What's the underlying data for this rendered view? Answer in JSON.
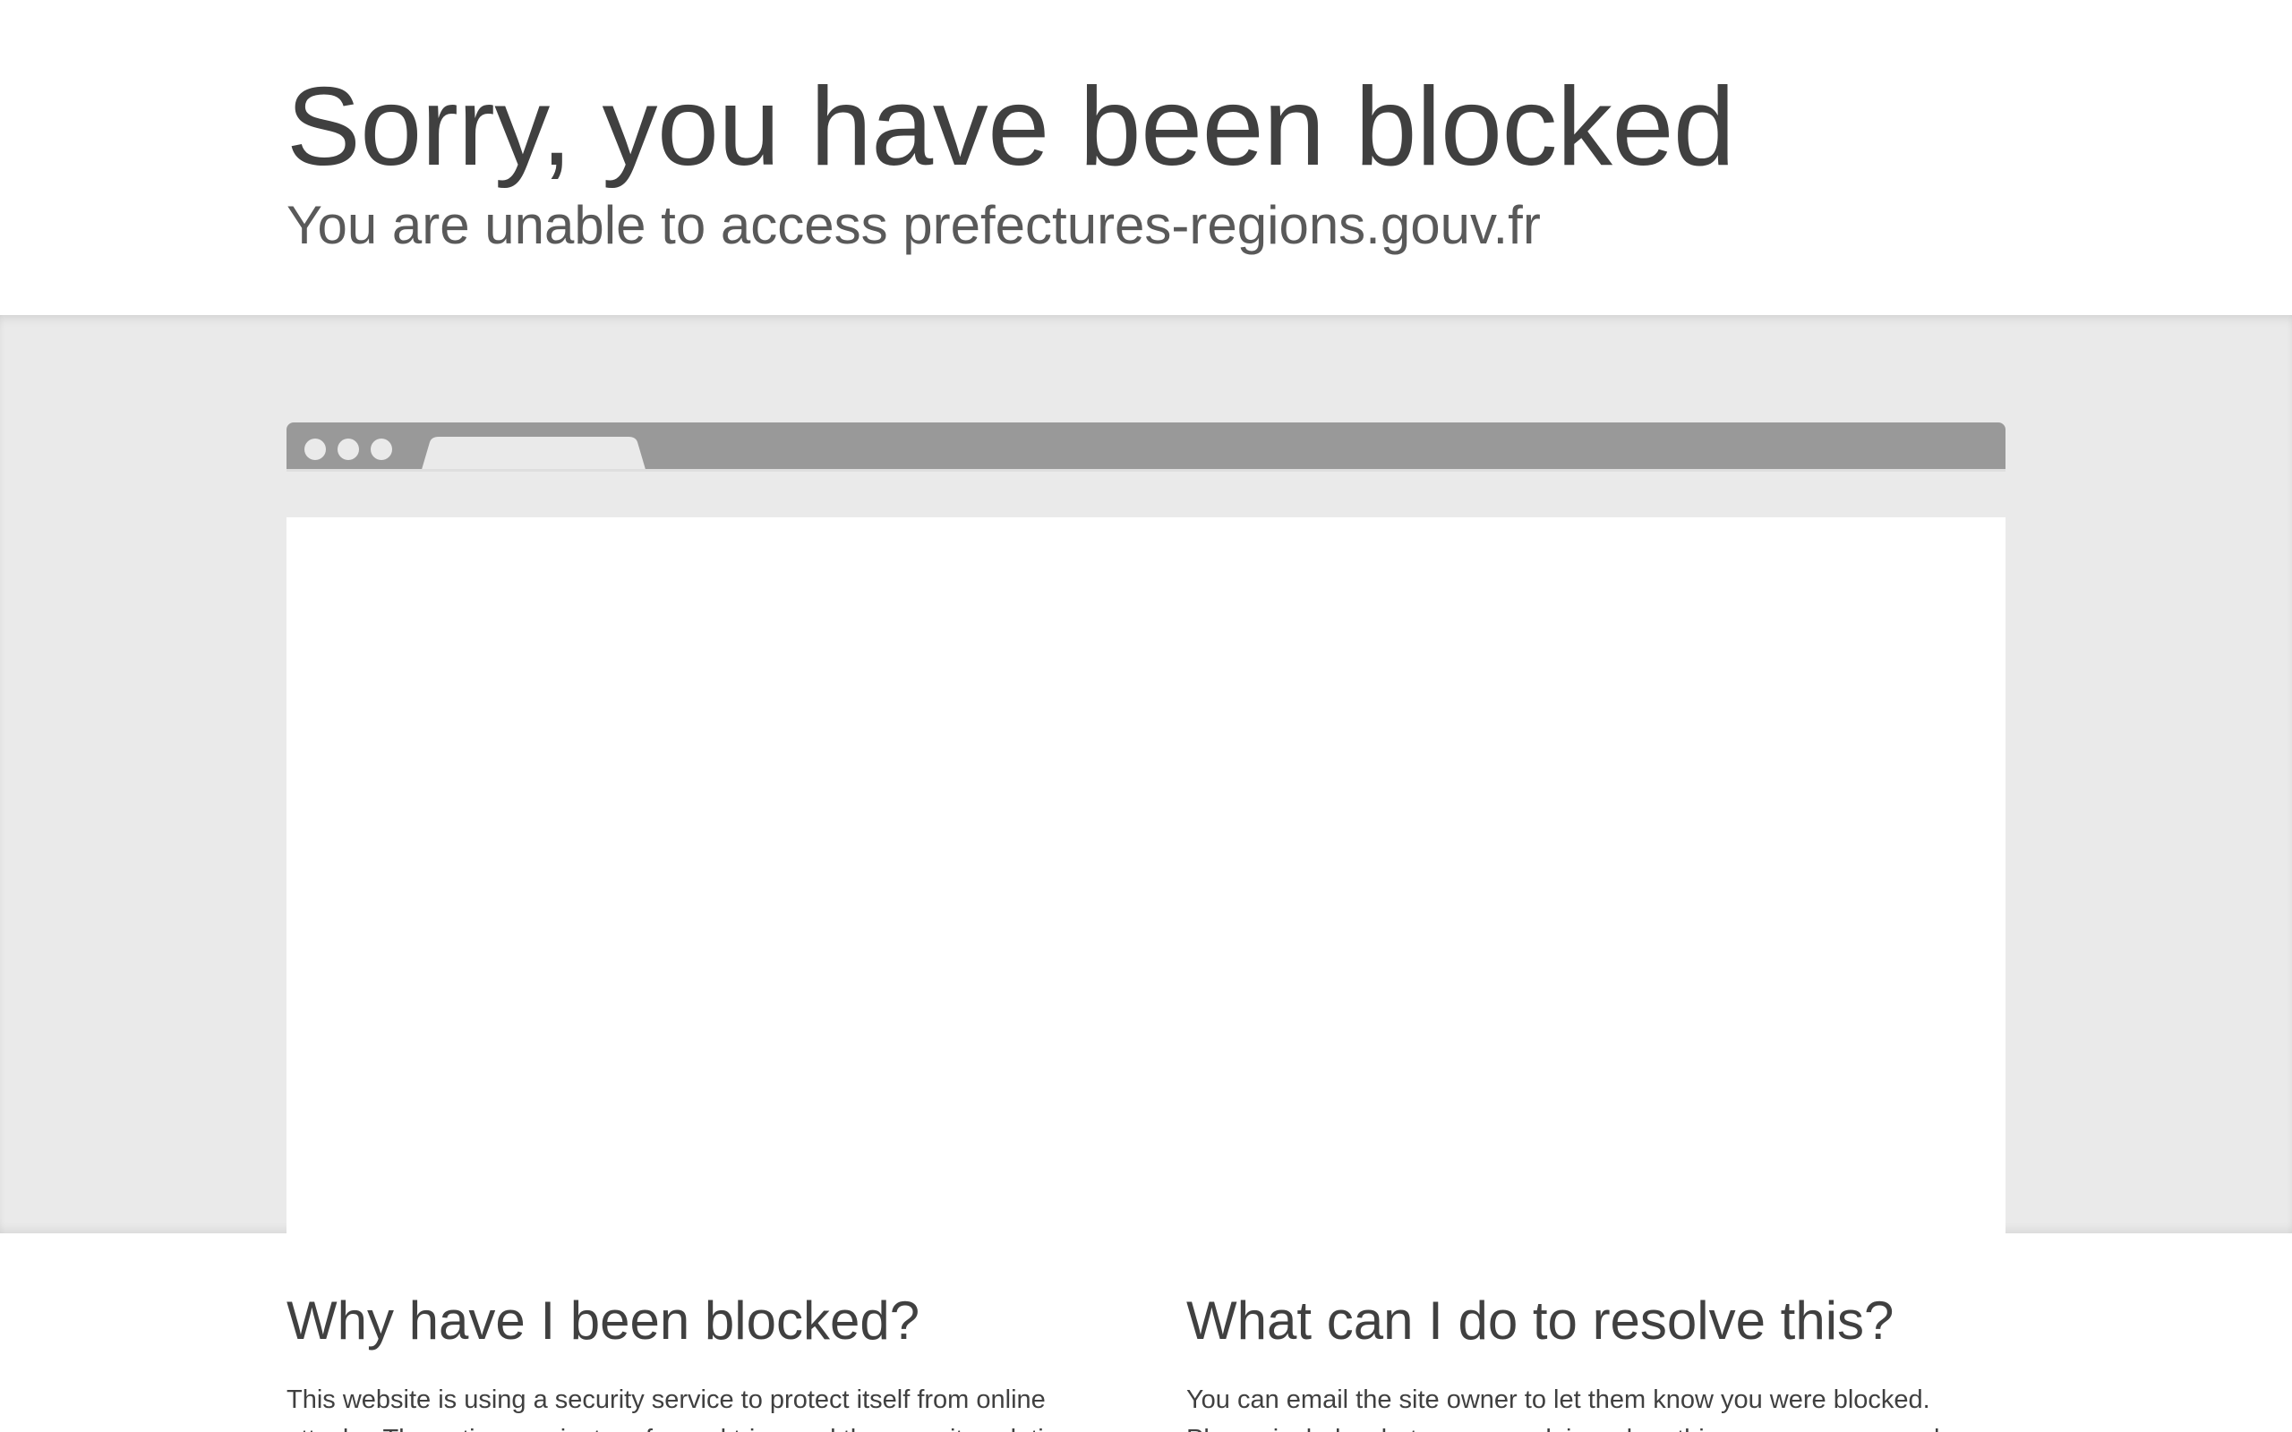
{
  "header": {
    "title": "Sorry, you have been blocked",
    "subtitle": "You are unable to access prefectures-regions.gouv.fr"
  },
  "browser_mock": {
    "dots": [
      "dot",
      "dot",
      "dot"
    ],
    "icon": "browser-window-icon"
  },
  "sections": {
    "why": {
      "heading": "Why have I been blocked?",
      "text": "This website is using a security service to protect itself from online attacks. The action you just performed triggered the security solution."
    },
    "resolve": {
      "heading": "What can I do to resolve this?",
      "text": "You can email the site owner to let them know you were blocked. Please include what you were doing when this page came up and"
    }
  },
  "colors": {
    "text": "#404040",
    "subtext": "#595959",
    "band": "#eaeaea",
    "browser_bar": "#999999",
    "background": "#ffffff"
  }
}
